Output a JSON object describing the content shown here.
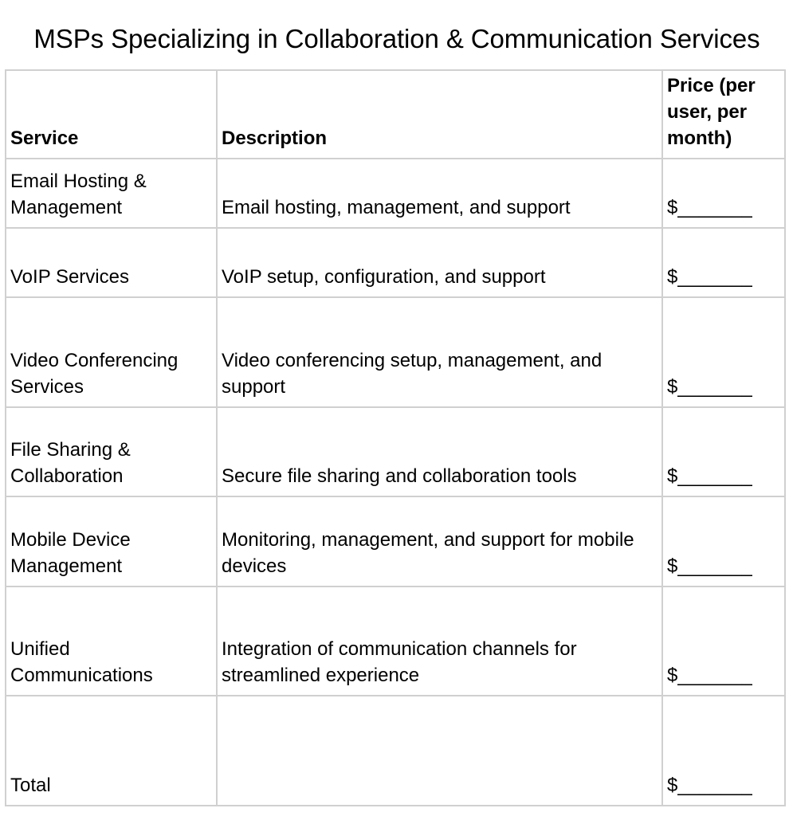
{
  "title": "MSPs Specializing in Collaboration & Communication Services",
  "table": {
    "headers": [
      "Service",
      "Description",
      "Price (per user, per month)"
    ],
    "rows": [
      {
        "service": "Email Hosting & Management",
        "description": "Email hosting, management, and support",
        "price": "$_______"
      },
      {
        "service": "VoIP Services",
        "description": "VoIP setup, configuration, and support",
        "price": "$_______"
      },
      {
        "service": "Video Conferencing Services",
        "description": "Video conferencing setup, management, and support",
        "price": "$_______"
      },
      {
        "service": "File Sharing & Collaboration",
        "description": "Secure file sharing and collaboration tools",
        "price": "$_______"
      },
      {
        "service": "Mobile Device Management",
        "description": "Monitoring, management, and support for mobile devices",
        "price": "$_______"
      },
      {
        "service": "Unified Communications",
        "description": "Integration of communication channels for streamlined experience",
        "price": "$_______"
      },
      {
        "service": "Total",
        "description": "",
        "price": "$_______"
      }
    ]
  }
}
